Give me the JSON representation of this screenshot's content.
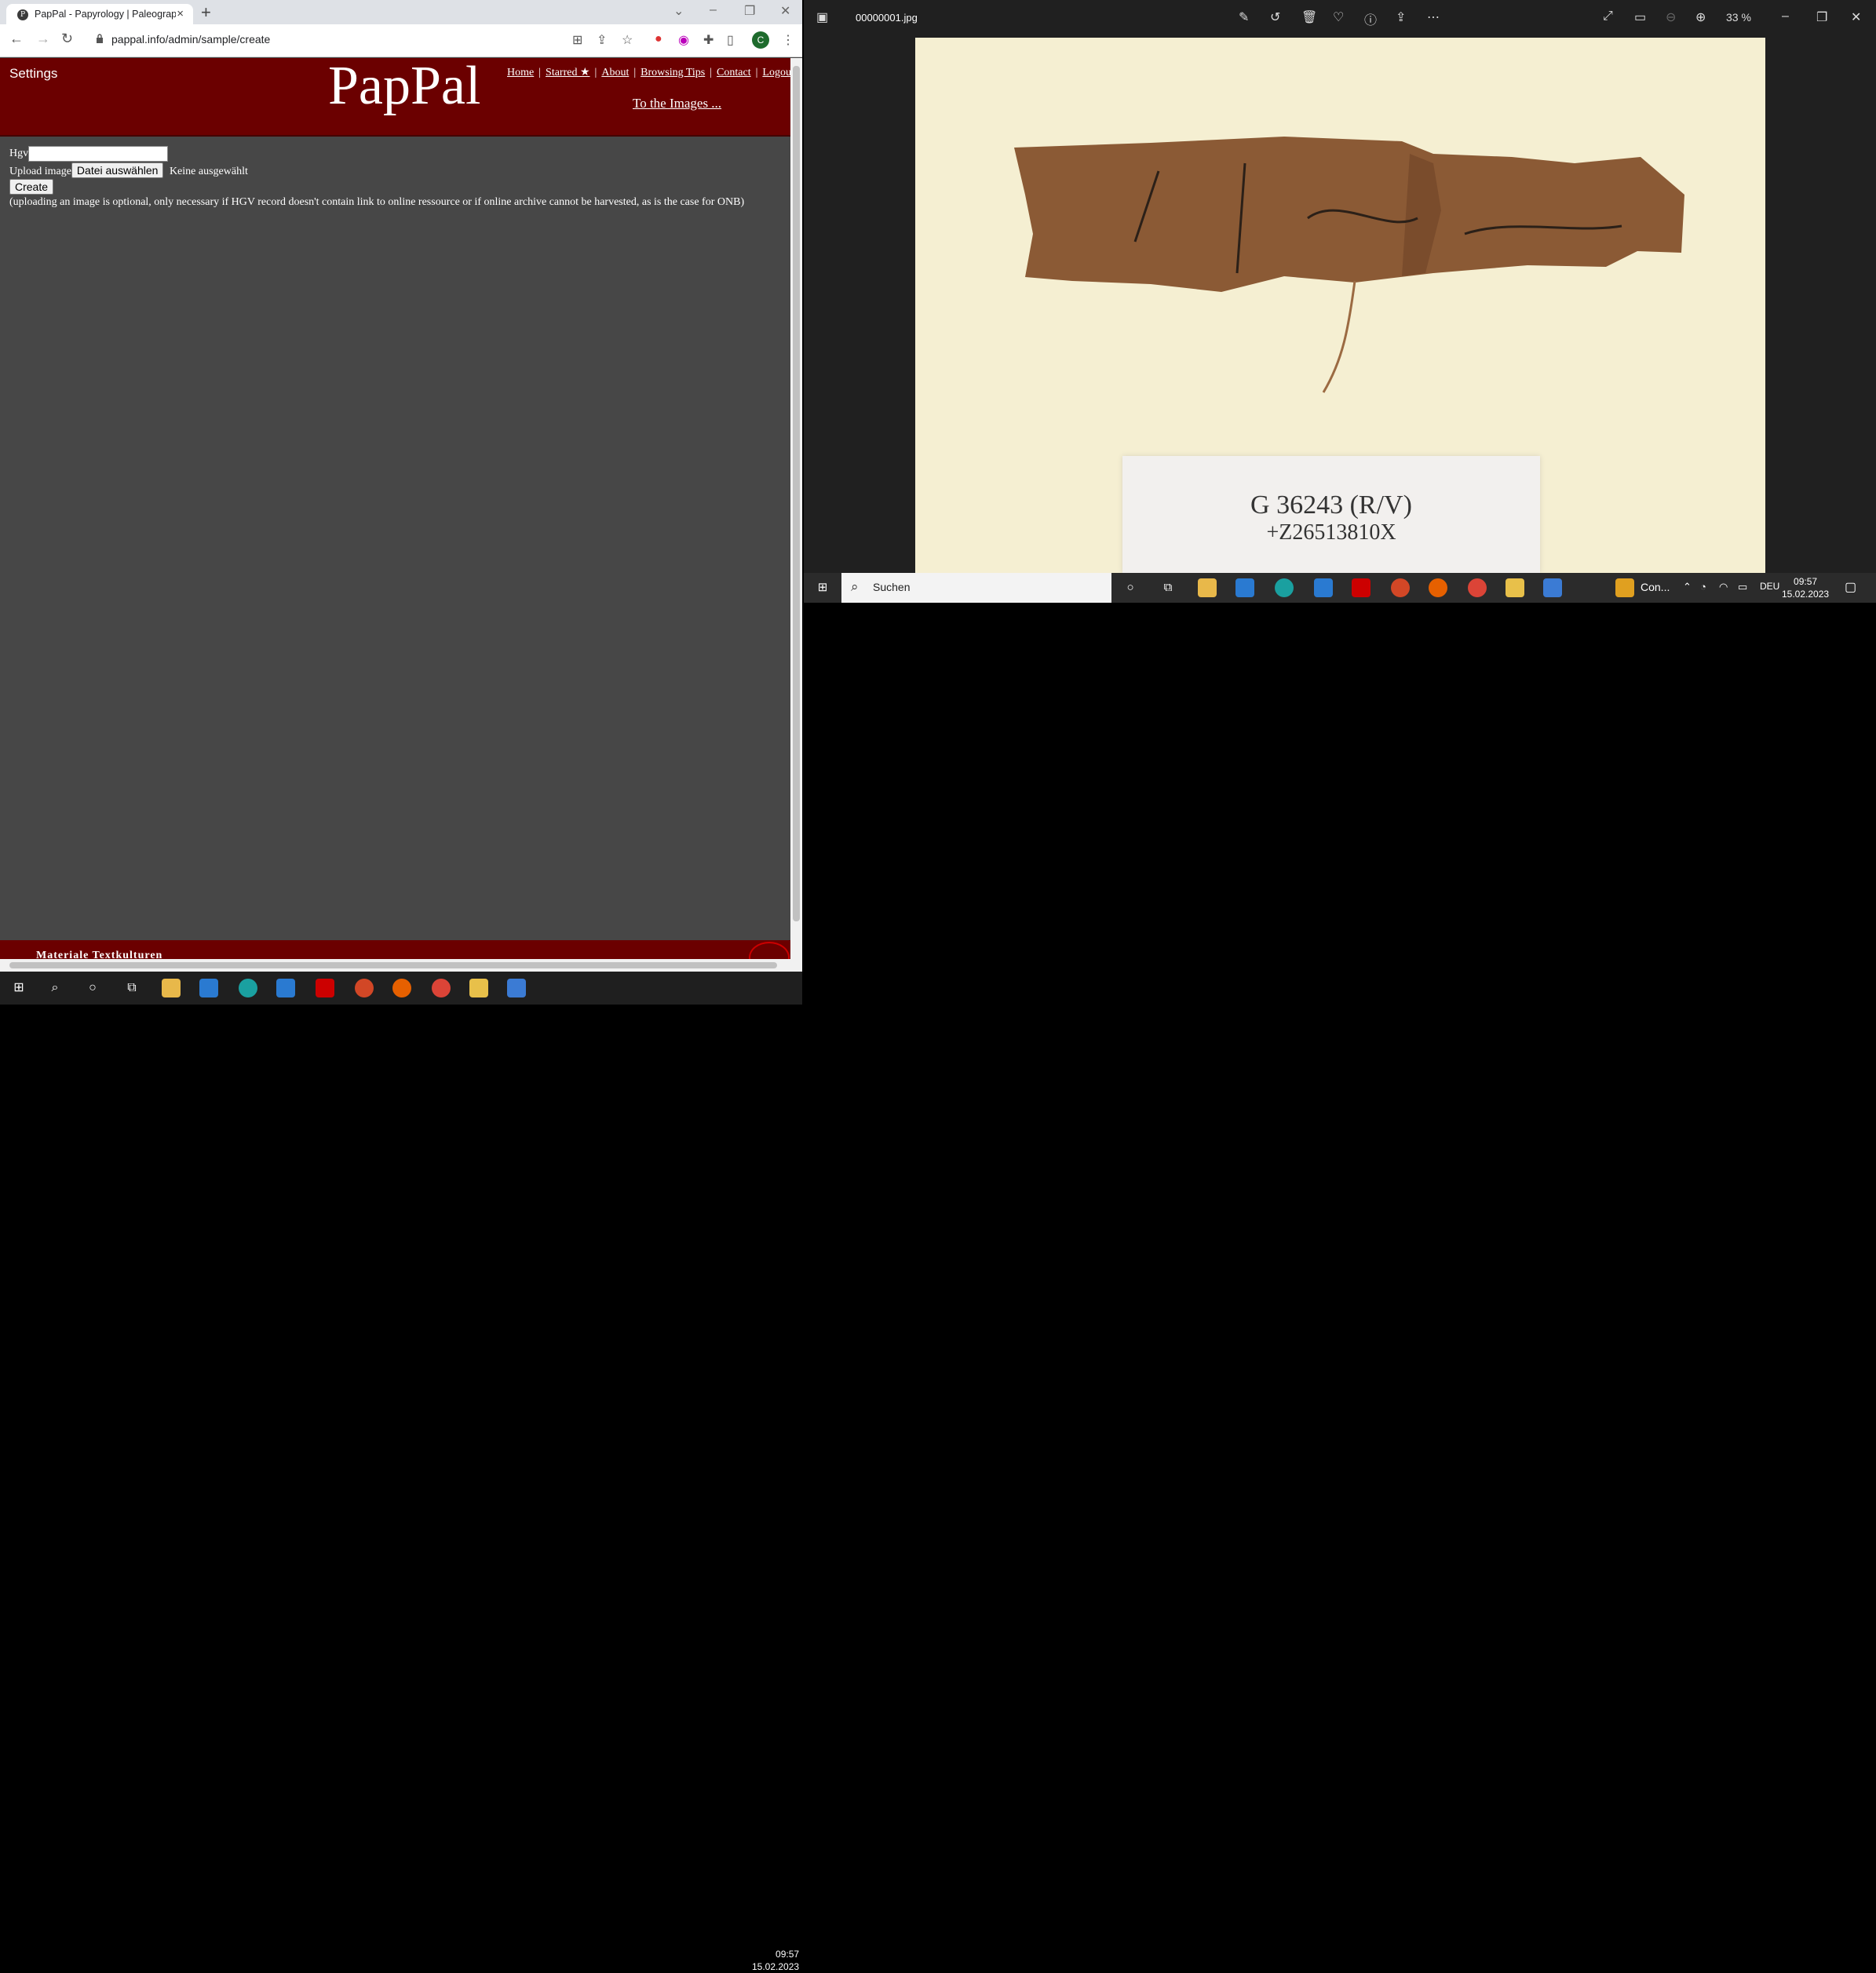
{
  "browser": {
    "tab_title": "PapPal - Papyrology | Paleograph",
    "tab_favicon": "P",
    "url": "pappal.info/admin/sample/create",
    "profile_initial": "C"
  },
  "site": {
    "settings_label": "Settings",
    "logo": "PapPal",
    "nav": [
      "Home",
      "Starred ★",
      "About",
      "Browsing Tips",
      "Contact",
      "Logout"
    ],
    "to_images": "To the Images ...",
    "form": {
      "hgv_label": "Hgv",
      "upload_label": "Upload image",
      "file_button": "Datei auswählen",
      "file_status": "Keine ausgewählt",
      "create_button": "Create",
      "note": "(uploading an image is optional, only necessary if HGV record doesn't contain link to online ressource or if online archive cannot be harvested, as is the case for ONB)"
    },
    "footer_text": "Materiale Textkulturen"
  },
  "photos": {
    "filename": "00000001.jpg",
    "zoom": "33 %",
    "card_line1": "G 36243 (R/V)",
    "card_line2": "+Z26513810X"
  },
  "taskbar_left": {
    "time": "09:57",
    "date": "15.02.2023"
  },
  "taskbar_right": {
    "search_placeholder": "Suchen",
    "weather": "Con...",
    "lang": "DEU",
    "time": "09:57",
    "date": "15.02.2023"
  },
  "colors": {
    "header_bg": "#6b0000",
    "page_bg": "#474747",
    "paper_bg": "#f5efd2",
    "papyrus": "#8b5a35"
  }
}
